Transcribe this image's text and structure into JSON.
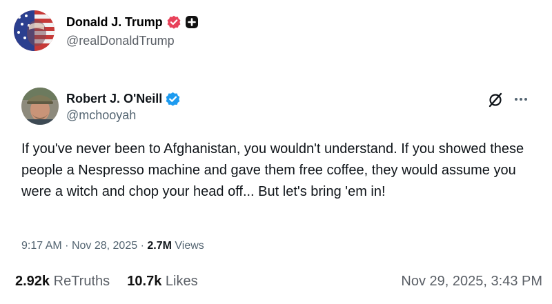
{
  "post": {
    "author_name": "Donald J. Trump",
    "author_handle": "@realDonaldTrump",
    "verified_badge_color": "#e8425a",
    "retruths_count": "2.92k",
    "retruths_label": "ReTruths",
    "likes_count": "10.7k",
    "likes_label": "Likes",
    "timestamp": "Nov 29, 2025, 3:43 PM"
  },
  "quoted": {
    "author_name": "Robert J. O'Neill",
    "author_handle": "@mchooyah",
    "verified_badge_color": "#1d9bf0",
    "text": "If you've never been to Afghanistan, you wouldn't understand. If you showed these people a Nespresso machine and gave them free coffee, they would assume you were a witch and chop your head off... But let's bring 'em in!",
    "time": "9:17 AM",
    "date": "Nov 28, 2025",
    "separator": "·",
    "views_count": "2.7M",
    "views_label": "Views"
  },
  "icons": {
    "grok": "grok-icon",
    "more": "more-icon"
  }
}
